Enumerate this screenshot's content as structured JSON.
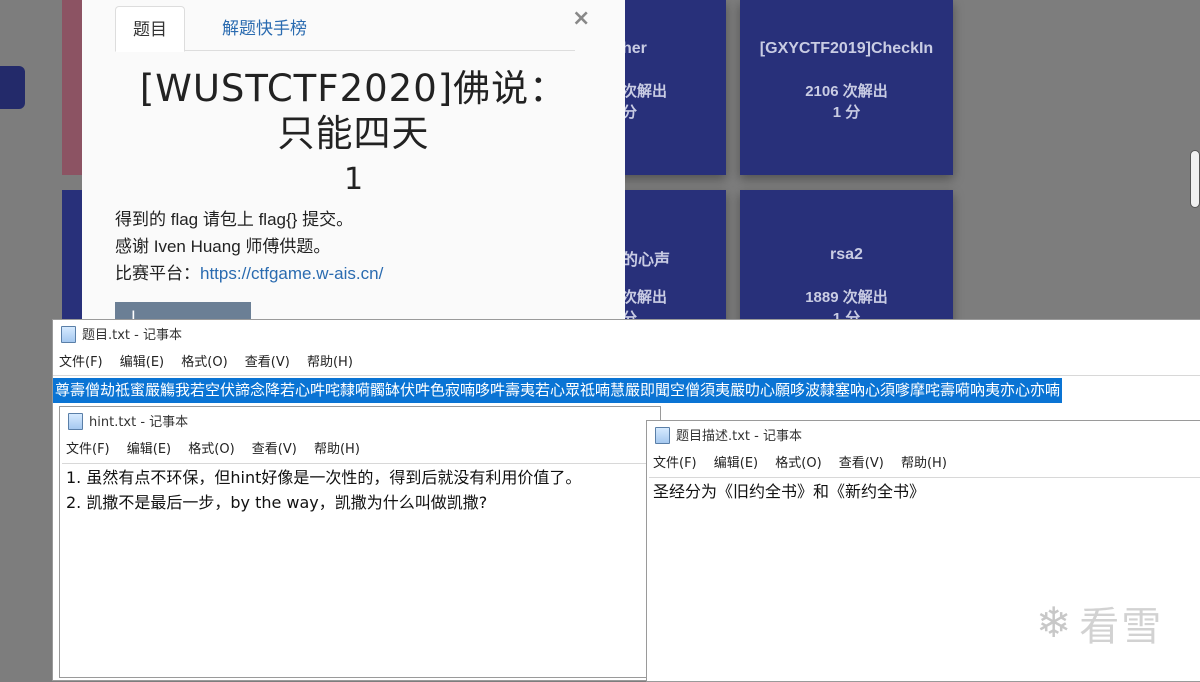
{
  "background": {
    "cards": [
      {
        "title": "her",
        "solves": "次解出",
        "score": "分"
      },
      {
        "title": "[GXYCTF2019]CheckIn",
        "solves": "2106 次解出",
        "score": "1 分"
      },
      {
        "title": "的心声",
        "solves": "次解出",
        "score": "分"
      },
      {
        "title": "rsa2",
        "solves": "1889 次解出",
        "score": "1 分"
      }
    ]
  },
  "modal": {
    "tabs": [
      "题目",
      "解题快手榜"
    ],
    "close": "×",
    "title": "[WUSTCTF2020]佛说：只能四天",
    "score": "1",
    "desc_line1": "得到的 flag 请包上 flag{} 提交。",
    "desc_line2": "感谢 Iven Huang 师傅供题。",
    "desc_line3_label": "比赛平台：",
    "desc_line3_link": "https://ctfgame.w-ais.cn/",
    "button_label": "I"
  },
  "notepad_main": {
    "title": "题目.txt - 记事本",
    "menu": [
      "文件(F)",
      "编辑(E)",
      "格式(O)",
      "查看(V)",
      "帮助(H)"
    ],
    "content": "尊壽僧劫祗蜜嚴觴我若空伏諦念降若心吽咤隸嗬髑缽伏吽色寂喃哆吽壽夷若心眾祗喃慧嚴即聞空僧須夷嚴叻心願哆波隸塞吶心須嗲摩咤壽嗬吶夷亦心亦喃"
  },
  "notepad_hint": {
    "title": "hint.txt - 记事本",
    "menu": [
      "文件(F)",
      "编辑(E)",
      "格式(O)",
      "查看(V)",
      "帮助(H)"
    ],
    "line1": "1. 虽然有点不环保，但hint好像是一次性的，得到后就没有利用价值了。",
    "line2": "2. 凯撒不是最后一步，by the way，凯撒为什么叫做凯撒?"
  },
  "notepad_desc": {
    "title": "题目描述.txt - 记事本",
    "menu": [
      "文件(F)",
      "编辑(E)",
      "格式(O)",
      "查看(V)",
      "帮助(H)"
    ],
    "content": "圣经分为《旧约全书》和《新约全书》"
  },
  "watermark": {
    "icon": "snowflake-icon",
    "text": "看雪"
  },
  "colors": {
    "card_bg": "#28307a",
    "selection": "#0a74d4",
    "link": "#2a6bb0"
  }
}
